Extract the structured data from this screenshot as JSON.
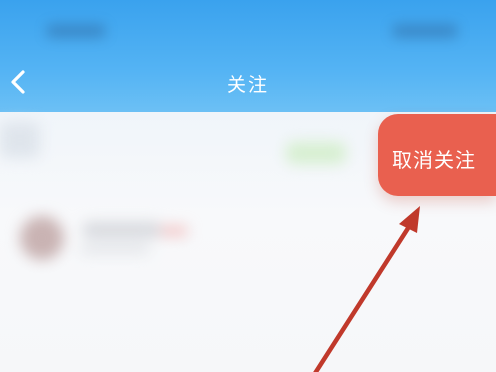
{
  "header": {
    "title": "关注",
    "back_icon": "chevron-left-icon"
  },
  "colors": {
    "header_top": "#3aa2ee",
    "header_bottom": "#6cc0f5",
    "unfollow_button": "#e9604f",
    "annotation_arrow": "#c0392b"
  },
  "swipe_action": {
    "unfollow_label": "取消关注"
  }
}
